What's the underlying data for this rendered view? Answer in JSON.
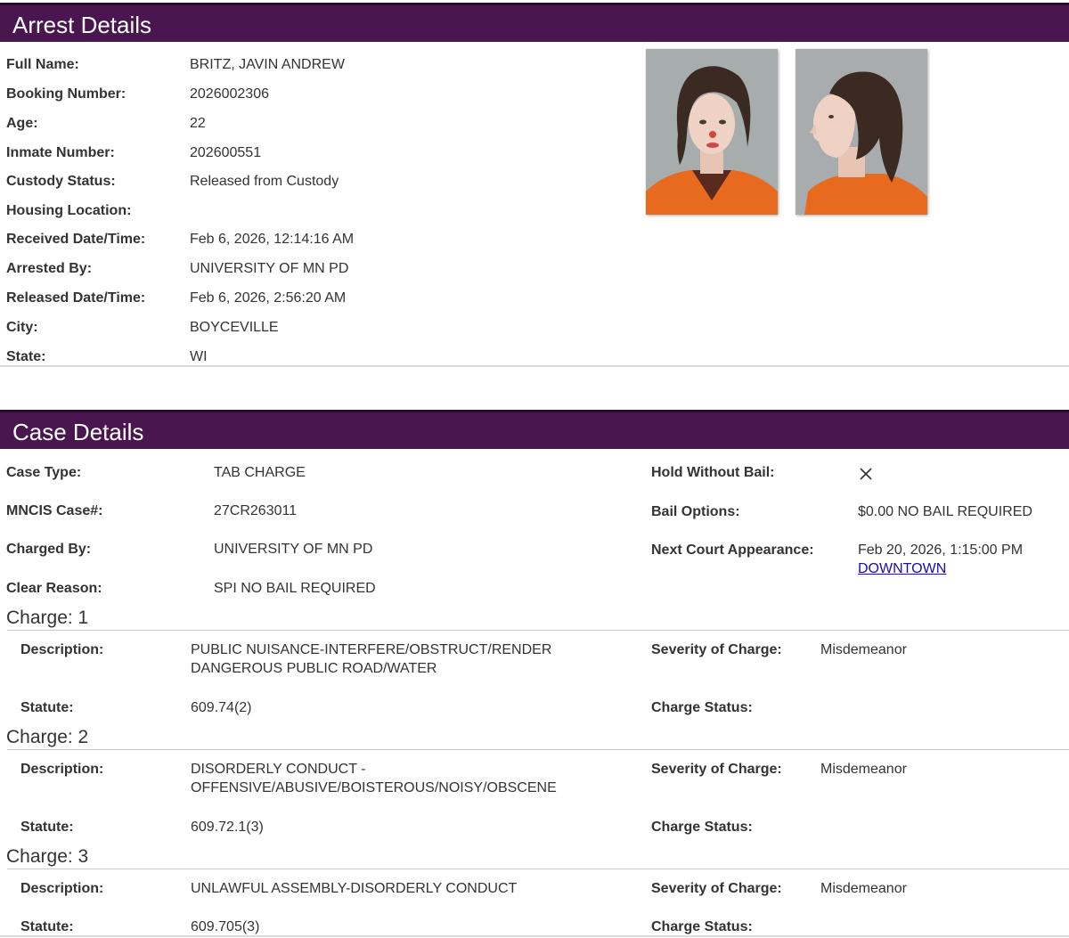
{
  "arrest": {
    "title": "Arrest Details",
    "fields": [
      {
        "label": "Full Name:",
        "value": "BRITZ, JAVIN ANDREW"
      },
      {
        "label": "Booking Number:",
        "value": "2026002306"
      },
      {
        "label": "Age:",
        "value": "22"
      },
      {
        "label": "Inmate Number:",
        "value": "202600551"
      },
      {
        "label": "Custody Status:",
        "value": "Released from Custody"
      },
      {
        "label": "Housing Location:",
        "value": ""
      },
      {
        "label": "Received Date/Time:",
        "value": "Feb 6, 2026, 12:14:16 AM"
      },
      {
        "label": "Arrested By:",
        "value": "UNIVERSITY OF MN PD"
      },
      {
        "label": "Released Date/Time:",
        "value": "Feb 6, 2026, 2:56:20 AM"
      },
      {
        "label": "City:",
        "value": "BOYCEVILLE"
      },
      {
        "label": "State:",
        "value": "WI"
      }
    ]
  },
  "case": {
    "title": "Case Details",
    "left": [
      {
        "label": "Case Type:",
        "value": "TAB CHARGE"
      },
      {
        "label": "MNCIS Case#:",
        "value": "27CR263011"
      },
      {
        "label": "Charged By:",
        "value": "UNIVERSITY OF MN PD"
      },
      {
        "label": "Clear Reason:",
        "value": "SPI NO BAIL REQUIRED"
      }
    ],
    "right": {
      "hold_label": "Hold Without Bail:",
      "hold_icon": "close-x-icon",
      "bail_label": "Bail Options:",
      "bail_value": "$0.00 NO BAIL REQUIRED",
      "court_label": "Next Court Appearance:",
      "court_value": "Feb 20, 2026, 1:15:00 PM",
      "court_location": "DOWNTOWN"
    }
  },
  "charges": [
    {
      "title": "Charge: 1",
      "description_label": "Description:",
      "description_lines": [
        "PUBLIC NUISANCE-INTERFERE/OBSTRUCT/RENDER",
        "DANGEROUS PUBLIC ROAD/WATER"
      ],
      "severity_label": "Severity of Charge:",
      "severity": "Misdemeanor",
      "statute_label": "Statute:",
      "statute": "609.74(2)",
      "status_label": "Charge Status:",
      "status": ""
    },
    {
      "title": "Charge: 2",
      "description_label": "Description:",
      "description_lines": [
        "DISORDERLY CONDUCT -",
        "OFFENSIVE/ABUSIVE/BOISTEROUS/NOISY/OBSCENE"
      ],
      "severity_label": "Severity of Charge:",
      "severity": "Misdemeanor",
      "statute_label": "Statute:",
      "statute": "609.72.1(3)",
      "status_label": "Charge Status:",
      "status": ""
    },
    {
      "title": "Charge: 3",
      "description_label": "Description:",
      "description_lines": [
        "UNLAWFUL ASSEMBLY-DISORDERLY CONDUCT"
      ],
      "severity_label": "Severity of Charge:",
      "severity": "Misdemeanor",
      "statute_label": "Statute:",
      "statute": "609.705(3)",
      "status_label": "Charge Status:",
      "status": ""
    }
  ],
  "colors": {
    "header_bg": "#4a1650",
    "link": "#1a0dab",
    "uniform": "#e86a1e"
  }
}
